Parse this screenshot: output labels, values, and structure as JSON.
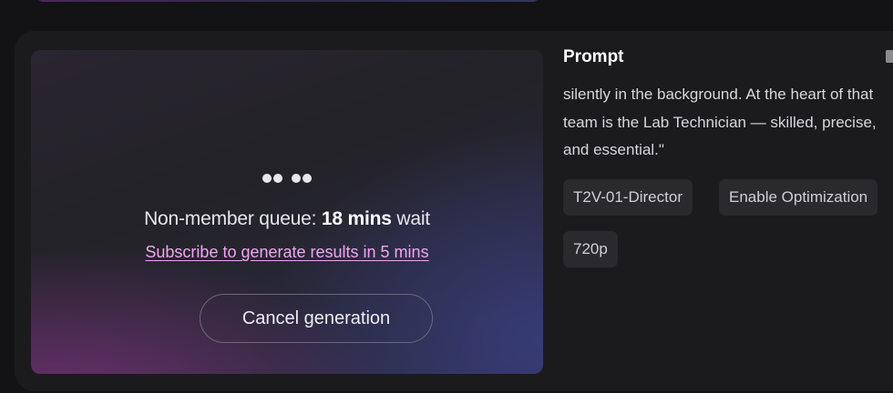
{
  "preview": {
    "queue_prefix": "Non-member queue: ",
    "queue_time": "18 mins",
    "queue_suffix": " wait",
    "subscribe_link": "Subscribe to generate results in 5 mins",
    "cancel_button": "Cancel generation"
  },
  "prompt": {
    "title": "Prompt",
    "text": "silently in the background. At the heart of that team is the Lab Technician — skilled, precise, and essential.\"",
    "copy_icon": "copy-icon"
  },
  "tags": {
    "model": "T2V-01-Director",
    "optimization": "Enable Optimization",
    "resolution": "720p"
  },
  "colors": {
    "background": "#131316",
    "card": "#1b1b1e",
    "link": "#f0a6f0",
    "tag_bg": "#2a2a2e"
  }
}
